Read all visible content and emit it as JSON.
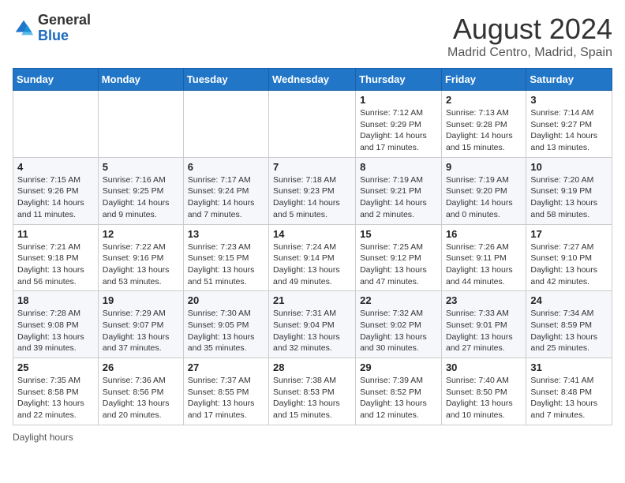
{
  "header": {
    "logo_line1": "General",
    "logo_line2": "Blue",
    "title": "August 2024",
    "subtitle": "Madrid Centro, Madrid, Spain"
  },
  "columns": [
    "Sunday",
    "Monday",
    "Tuesday",
    "Wednesday",
    "Thursday",
    "Friday",
    "Saturday"
  ],
  "weeks": [
    [
      {
        "day": "",
        "info": ""
      },
      {
        "day": "",
        "info": ""
      },
      {
        "day": "",
        "info": ""
      },
      {
        "day": "",
        "info": ""
      },
      {
        "day": "1",
        "info": "Sunrise: 7:12 AM\nSunset: 9:29 PM\nDaylight: 14 hours\nand 17 minutes."
      },
      {
        "day": "2",
        "info": "Sunrise: 7:13 AM\nSunset: 9:28 PM\nDaylight: 14 hours\nand 15 minutes."
      },
      {
        "day": "3",
        "info": "Sunrise: 7:14 AM\nSunset: 9:27 PM\nDaylight: 14 hours\nand 13 minutes."
      }
    ],
    [
      {
        "day": "4",
        "info": "Sunrise: 7:15 AM\nSunset: 9:26 PM\nDaylight: 14 hours\nand 11 minutes."
      },
      {
        "day": "5",
        "info": "Sunrise: 7:16 AM\nSunset: 9:25 PM\nDaylight: 14 hours\nand 9 minutes."
      },
      {
        "day": "6",
        "info": "Sunrise: 7:17 AM\nSunset: 9:24 PM\nDaylight: 14 hours\nand 7 minutes."
      },
      {
        "day": "7",
        "info": "Sunrise: 7:18 AM\nSunset: 9:23 PM\nDaylight: 14 hours\nand 5 minutes."
      },
      {
        "day": "8",
        "info": "Sunrise: 7:19 AM\nSunset: 9:21 PM\nDaylight: 14 hours\nand 2 minutes."
      },
      {
        "day": "9",
        "info": "Sunrise: 7:19 AM\nSunset: 9:20 PM\nDaylight: 14 hours\nand 0 minutes."
      },
      {
        "day": "10",
        "info": "Sunrise: 7:20 AM\nSunset: 9:19 PM\nDaylight: 13 hours\nand 58 minutes."
      }
    ],
    [
      {
        "day": "11",
        "info": "Sunrise: 7:21 AM\nSunset: 9:18 PM\nDaylight: 13 hours\nand 56 minutes."
      },
      {
        "day": "12",
        "info": "Sunrise: 7:22 AM\nSunset: 9:16 PM\nDaylight: 13 hours\nand 53 minutes."
      },
      {
        "day": "13",
        "info": "Sunrise: 7:23 AM\nSunset: 9:15 PM\nDaylight: 13 hours\nand 51 minutes."
      },
      {
        "day": "14",
        "info": "Sunrise: 7:24 AM\nSunset: 9:14 PM\nDaylight: 13 hours\nand 49 minutes."
      },
      {
        "day": "15",
        "info": "Sunrise: 7:25 AM\nSunset: 9:12 PM\nDaylight: 13 hours\nand 47 minutes."
      },
      {
        "day": "16",
        "info": "Sunrise: 7:26 AM\nSunset: 9:11 PM\nDaylight: 13 hours\nand 44 minutes."
      },
      {
        "day": "17",
        "info": "Sunrise: 7:27 AM\nSunset: 9:10 PM\nDaylight: 13 hours\nand 42 minutes."
      }
    ],
    [
      {
        "day": "18",
        "info": "Sunrise: 7:28 AM\nSunset: 9:08 PM\nDaylight: 13 hours\nand 39 minutes."
      },
      {
        "day": "19",
        "info": "Sunrise: 7:29 AM\nSunset: 9:07 PM\nDaylight: 13 hours\nand 37 minutes."
      },
      {
        "day": "20",
        "info": "Sunrise: 7:30 AM\nSunset: 9:05 PM\nDaylight: 13 hours\nand 35 minutes."
      },
      {
        "day": "21",
        "info": "Sunrise: 7:31 AM\nSunset: 9:04 PM\nDaylight: 13 hours\nand 32 minutes."
      },
      {
        "day": "22",
        "info": "Sunrise: 7:32 AM\nSunset: 9:02 PM\nDaylight: 13 hours\nand 30 minutes."
      },
      {
        "day": "23",
        "info": "Sunrise: 7:33 AM\nSunset: 9:01 PM\nDaylight: 13 hours\nand 27 minutes."
      },
      {
        "day": "24",
        "info": "Sunrise: 7:34 AM\nSunset: 8:59 PM\nDaylight: 13 hours\nand 25 minutes."
      }
    ],
    [
      {
        "day": "25",
        "info": "Sunrise: 7:35 AM\nSunset: 8:58 PM\nDaylight: 13 hours\nand 22 minutes."
      },
      {
        "day": "26",
        "info": "Sunrise: 7:36 AM\nSunset: 8:56 PM\nDaylight: 13 hours\nand 20 minutes."
      },
      {
        "day": "27",
        "info": "Sunrise: 7:37 AM\nSunset: 8:55 PM\nDaylight: 13 hours\nand 17 minutes."
      },
      {
        "day": "28",
        "info": "Sunrise: 7:38 AM\nSunset: 8:53 PM\nDaylight: 13 hours\nand 15 minutes."
      },
      {
        "day": "29",
        "info": "Sunrise: 7:39 AM\nSunset: 8:52 PM\nDaylight: 13 hours\nand 12 minutes."
      },
      {
        "day": "30",
        "info": "Sunrise: 7:40 AM\nSunset: 8:50 PM\nDaylight: 13 hours\nand 10 minutes."
      },
      {
        "day": "31",
        "info": "Sunrise: 7:41 AM\nSunset: 8:48 PM\nDaylight: 13 hours\nand 7 minutes."
      }
    ]
  ],
  "legend": "Daylight hours"
}
